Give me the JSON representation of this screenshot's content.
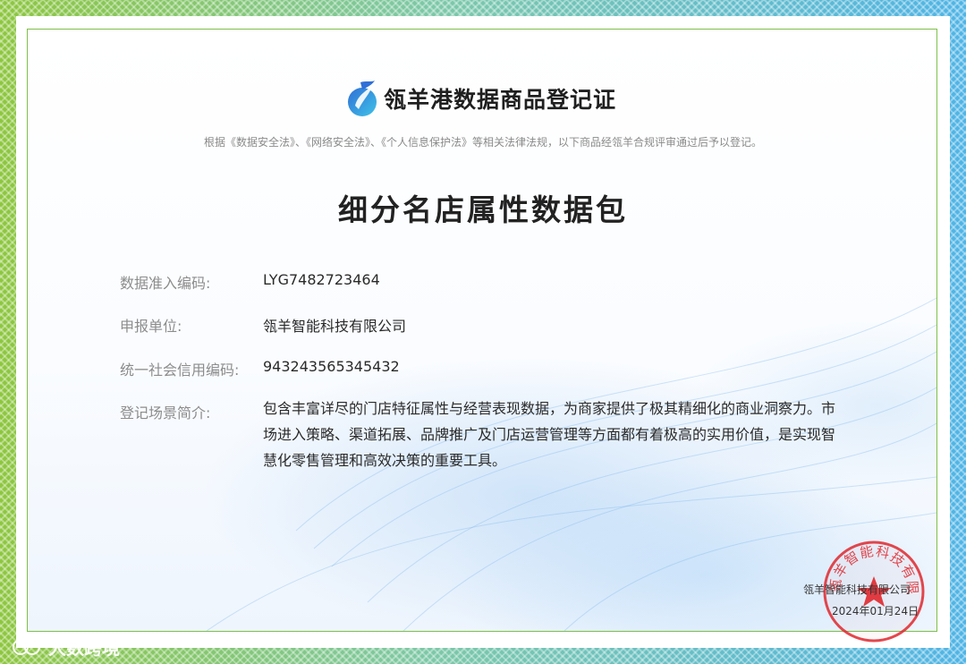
{
  "certificate": {
    "title": "瓴羊港数据商品登记证",
    "law_statement": "根据《数据安全法》、《网络安全法》、《个人信息保护法》等相关法律法规，以下商品经瓴羊合规评审通过后予以登记。",
    "product_name": "细分名店属性数据包",
    "fields": [
      {
        "label": "数据准入编码:",
        "value": "LYG7482723464"
      },
      {
        "label": "申报单位:",
        "value": "瓴羊智能科技有限公司"
      },
      {
        "label": "统一社会信用编码:",
        "value": "943243565345432"
      },
      {
        "label": "登记场景简介:",
        "value": "包含丰富详尽的门店特征属性与经营表现数据，为商家提供了极其精细化的商业洞察力。市场进入策略、渠道拓展、品牌推广及门店运营管理等方面都有着极高的实用价值，是实现智慧化零售管理和高效决策的重要工具。"
      }
    ],
    "issuer": "瓴羊智能科技有限公司",
    "issue_date": "2024年01月24日",
    "seal_text": "瓴羊智能科技有限公司",
    "watermark": "大数跨境"
  },
  "colors": {
    "border_green": "#8dc63f",
    "border_blue": "#4fb4e6",
    "seal_red": "#e0282e"
  }
}
